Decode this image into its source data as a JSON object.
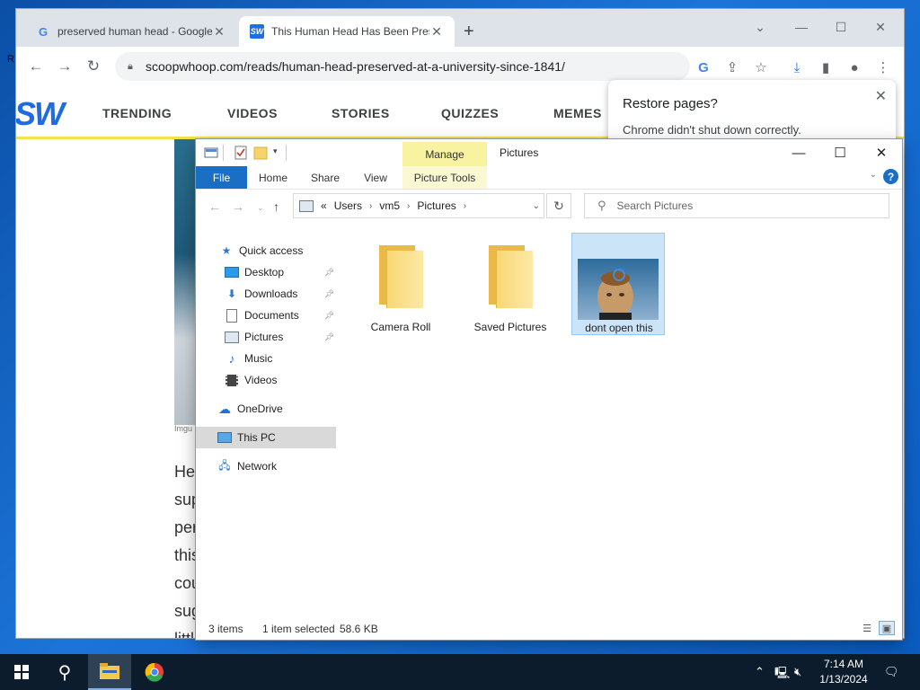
{
  "desktop": {
    "stray_text": "R"
  },
  "chrome": {
    "tabs": [
      {
        "title": "preserved human head - Google",
        "favicon": "google-g-icon"
      },
      {
        "title": "This Human Head Has Been Pres",
        "favicon": "scoopwhoop-sw-icon"
      }
    ],
    "new_tab": "+",
    "url": "scoopwhoop.com/reads/human-head-preserved-at-a-university-since-1841/",
    "site": {
      "logo": "SW",
      "nav": [
        "TRENDING",
        "VIDEOS",
        "STORIES",
        "QUIZZES",
        "MEMES"
      ],
      "caption": "Imgu",
      "article_lines": [
        "He",
        "sup",
        "per",
        "this",
        "cou",
        "sug",
        "littl"
      ]
    },
    "restore_popup": {
      "title": "Restore pages?",
      "subtitle": "Chrome didn't shut down correctly."
    }
  },
  "explorer": {
    "manage_tab": "Manage",
    "window_title": "Pictures",
    "ribbon": {
      "file": "File",
      "home": "Home",
      "share": "Share",
      "view": "View",
      "picture_tools": "Picture Tools",
      "help": "?"
    },
    "address": {
      "prefix": "«",
      "crumbs": [
        "Users",
        "vm5",
        "Pictures"
      ]
    },
    "search_placeholder": "Search Pictures",
    "nav": {
      "quick_access": "Quick access",
      "desktop": "Desktop",
      "downloads": "Downloads",
      "documents": "Documents",
      "pictures": "Pictures",
      "music": "Music",
      "videos": "Videos",
      "onedrive": "OneDrive",
      "this_pc": "This PC",
      "network": "Network"
    },
    "items": [
      {
        "name": "Camera Roll",
        "type": "folder"
      },
      {
        "name": "Saved Pictures",
        "type": "folder"
      },
      {
        "name": "dont open this",
        "type": "image",
        "selected": true
      }
    ],
    "status": {
      "count": "3 items",
      "selected": "1 item selected",
      "size": "58.6 KB"
    }
  },
  "taskbar": {
    "time": "7:14 AM",
    "date": "1/13/2024"
  },
  "colors": {
    "accent": "#1a6fc4",
    "manage": "#f7f3a1",
    "selection": "#cce4f7"
  }
}
